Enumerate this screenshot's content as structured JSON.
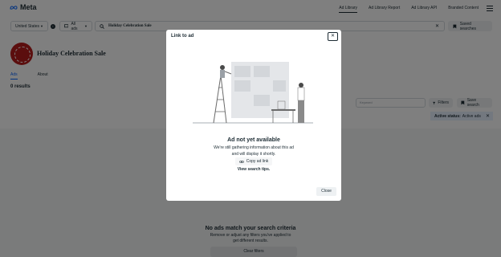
{
  "nav": {
    "brand": "Meta",
    "links": [
      {
        "label": "Ad Library",
        "active": true
      },
      {
        "label": "Ad Library Report",
        "active": false
      },
      {
        "label": "Ad Library API",
        "active": false
      },
      {
        "label": "Branded Content",
        "active": false
      }
    ]
  },
  "filters": {
    "country": "United States",
    "ad_type": "All ads",
    "search_query": "Holiday Celebration Sale",
    "saved_searches": "Saved searches"
  },
  "page": {
    "name": "Holiday Celebration Sale",
    "tabs": [
      "Ads",
      "About"
    ],
    "results": "0 results",
    "keyword_placeholder": "Keyword",
    "filters_button": "Filters",
    "save_search_button": "Save search",
    "status_label": "Active status:",
    "status_value": "Active ads"
  },
  "empty_state": {
    "title": "No ads match your search criteria",
    "subtitle": "Remove or adjust any filters you've applied to get different results.",
    "clear_button": "Clear filters"
  },
  "modal": {
    "title": "Link to ad",
    "heading": "Ad not yet available",
    "body": "We're still gathering information about this ad and will display it shortly.",
    "copy_button": "Copy ad link",
    "tips_link": "View search tips.",
    "close_button": "Close"
  },
  "colors": {
    "accent": "#0866ff",
    "text": "#1c2b33"
  }
}
